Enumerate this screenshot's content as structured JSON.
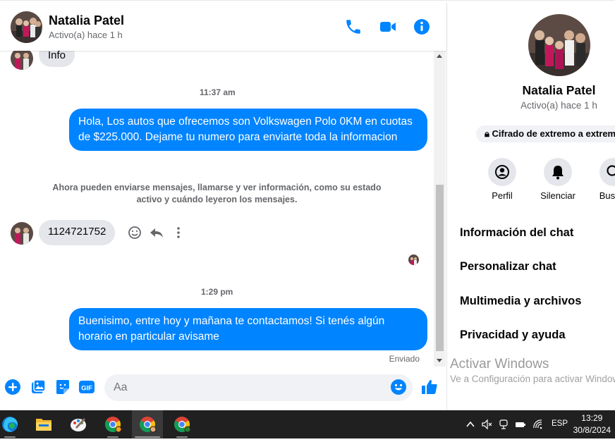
{
  "chat": {
    "contact_name": "Natalia Patel",
    "contact_status": "Activo(a) hace 1 h",
    "icons": [
      "phone-icon",
      "video-icon",
      "info-icon"
    ],
    "messages": {
      "partial_incoming": "Info",
      "time_1": "11:37 am",
      "outgoing_1": "Hola, Los autos que ofrecemos son Volkswagen Polo 0KM en cuotas de $225.000. Dejame tu numero para enviarte toda la informacion",
      "notice": "Ahora pueden enviarse mensajes, llamarse y ver información, como su estado activo y cuándo leyeron los mensajes.",
      "incoming_number": "1124721752",
      "time_2": "1:29 pm",
      "outgoing_2": "Buenisimo, entre hoy y mañana te contactamos! Si tenés algún horario en particular avisame",
      "sent_label": "Enviado"
    },
    "composer": {
      "placeholder": "Aa",
      "icons": [
        "plus-icon",
        "image-icon",
        "sticker-icon",
        "gif-icon",
        "emoji-icon",
        "like-icon"
      ],
      "gif_label": "GIF"
    },
    "accent_color": "#0084ff"
  },
  "side_panel": {
    "name": "Natalia Patel",
    "status": "Activo(a) hace 1 h",
    "e2e_label": "Cifrado de extremo a extremo",
    "actions": [
      {
        "label": "Perfil",
        "icon": "profile-icon"
      },
      {
        "label": "Silenciar",
        "icon": "bell-icon"
      },
      {
        "label": "Buscar",
        "icon": "search-icon"
      }
    ],
    "menu": [
      "Información del chat",
      "Personalizar chat",
      "Multimedia y archivos",
      "Privacidad y ayuda"
    ],
    "watermark_title": "Activar Windows",
    "watermark_text": "Ve a Configuración para activar Windows."
  },
  "taskbar": {
    "apps": [
      "edge-icon",
      "file-explorer-icon",
      "paint-icon",
      "chrome-icon",
      "chrome-profile-icon",
      "chrome-t-icon"
    ],
    "language": "ESP",
    "time": "13:29",
    "date": "30/8/2024"
  }
}
